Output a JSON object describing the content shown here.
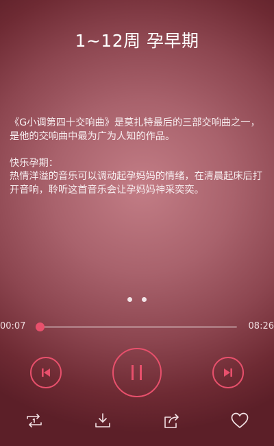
{
  "header": {
    "title": "1~12周 孕早期"
  },
  "description": {
    "paragraph1": "《G小调第四十交响曲》是莫扎特最后的三部交响曲之一，是他的交响曲中最为广为人知的作品。",
    "heading2": "快乐孕期：",
    "paragraph2": "热情洋溢的音乐可以调动起孕妈妈的情绪，在清晨起床后打开音响，聆听这首音乐会让孕妈妈神采奕奕。"
  },
  "pager": {
    "count": 2
  },
  "player": {
    "current_time": "00:07",
    "total_time": "08:26",
    "progress": 0.02,
    "state": "playing"
  },
  "controls": {
    "prev_icon": "skip-previous-icon",
    "play_pause_icon": "pause-icon",
    "next_icon": "skip-next-icon"
  },
  "actions": {
    "repeat_icon": "repeat-icon",
    "download_icon": "download-icon",
    "share_icon": "share-icon",
    "favorite_icon": "heart-icon"
  },
  "colors": {
    "accent": "#e8506c",
    "text": "#ffffff"
  }
}
